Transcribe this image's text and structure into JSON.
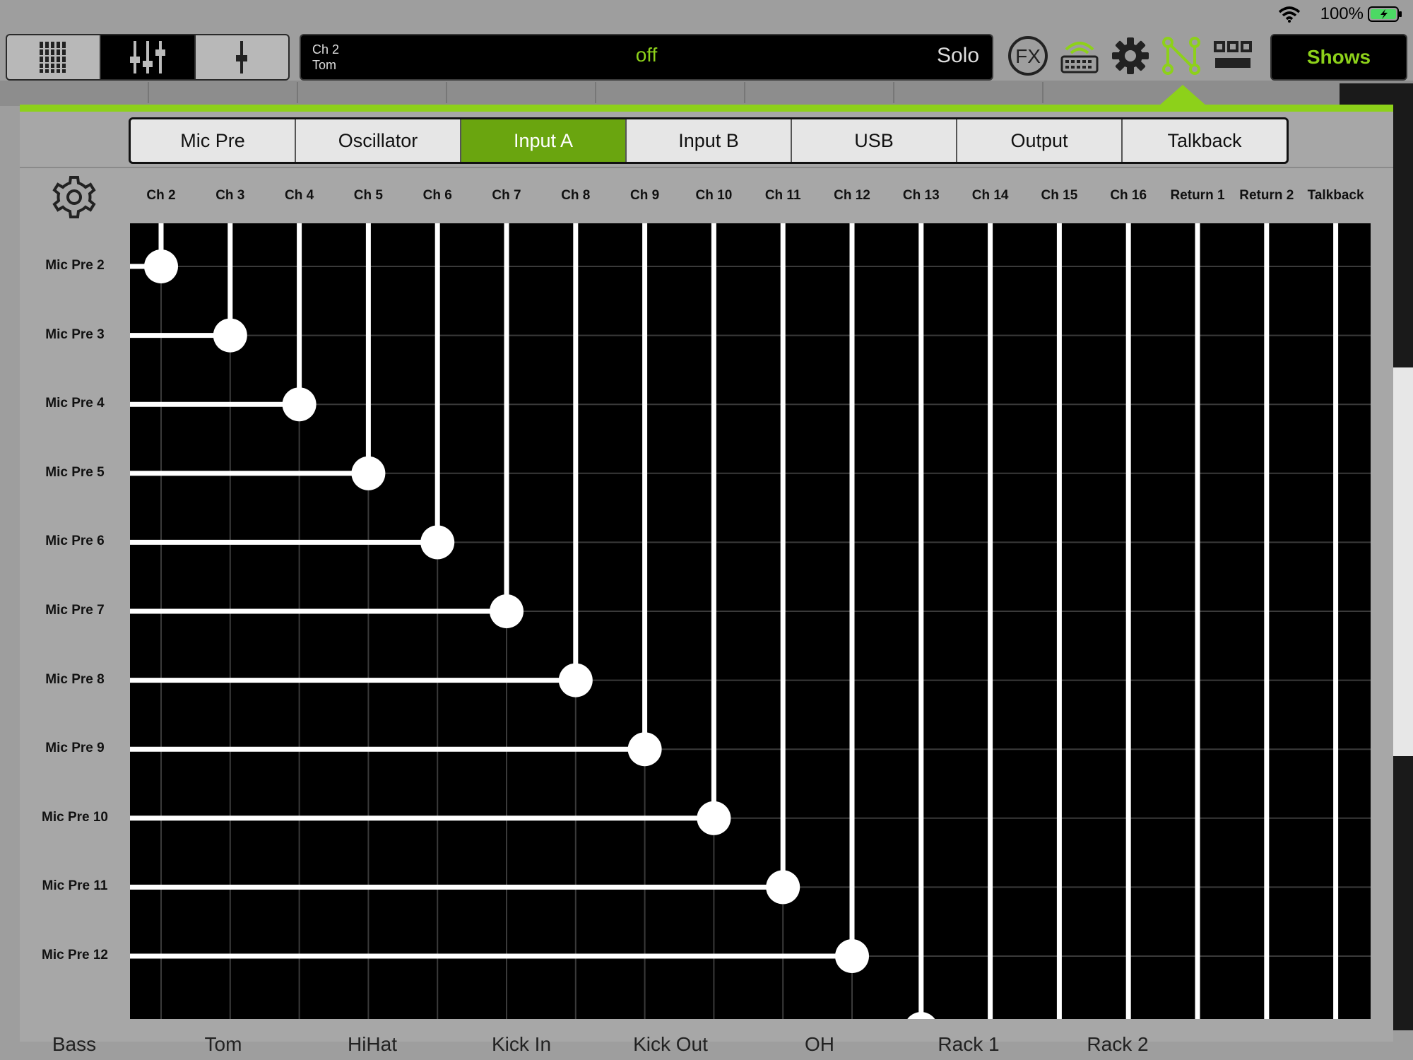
{
  "status_bar": {
    "battery_text": "100%",
    "icons": [
      "wifi-icon",
      "battery-charging-icon"
    ]
  },
  "toolbar": {
    "view_modes": [
      {
        "name": "meters-view",
        "icon": "meters-icon",
        "active": false
      },
      {
        "name": "mixer-view",
        "icon": "faders-icon",
        "active": true
      },
      {
        "name": "channel-view",
        "icon": "single-fader-icon",
        "active": false
      }
    ],
    "channel_display": {
      "channel": "Ch 2",
      "name": "Tom",
      "state": "off",
      "solo": "Solo"
    },
    "tools": [
      {
        "name": "fx-button",
        "icon": "fx-icon"
      },
      {
        "name": "keyboard-button",
        "icon": "keyboard-wifi-icon"
      },
      {
        "name": "settings-button",
        "icon": "gear-icon"
      },
      {
        "name": "patchbay-button",
        "icon": "patchbay-icon",
        "active": true
      },
      {
        "name": "layout-button",
        "icon": "grid-layout-icon"
      }
    ],
    "shows_label": "Shows"
  },
  "background_channel_names": [
    "Bass",
    "Tom",
    "HiHat",
    "Kick In",
    "Kick Out",
    "OH",
    "Rack 1",
    "Rack 2"
  ],
  "patchbay": {
    "tabs": [
      {
        "label": "Mic Pre",
        "active": false
      },
      {
        "label": "Oscillator",
        "active": false
      },
      {
        "label": "Input A",
        "active": true
      },
      {
        "label": "Input B",
        "active": false
      },
      {
        "label": "USB",
        "active": false
      },
      {
        "label": "Output",
        "active": false
      },
      {
        "label": "Talkback",
        "active": false
      }
    ],
    "settings_icon": "gear-icon",
    "destinations": [
      "Ch 2",
      "Ch 3",
      "Ch 4",
      "Ch 5",
      "Ch 6",
      "Ch 7",
      "Ch 8",
      "Ch 9",
      "Ch 10",
      "Ch 11",
      "Ch 12",
      "Ch 13",
      "Ch 14",
      "Ch 15",
      "Ch 16",
      "Return 1",
      "Return 2",
      "Talkback"
    ],
    "sources": [
      "Mic Pre 2",
      "Mic Pre 3",
      "Mic Pre 4",
      "Mic Pre 5",
      "Mic Pre 6",
      "Mic Pre 7",
      "Mic Pre 8",
      "Mic Pre 9",
      "Mic Pre 10",
      "Mic Pre 11",
      "Mic Pre 12"
    ],
    "routes": [
      {
        "source": "Mic Pre 2",
        "destination": "Ch 2"
      },
      {
        "source": "Mic Pre 3",
        "destination": "Ch 3"
      },
      {
        "source": "Mic Pre 4",
        "destination": "Ch 4"
      },
      {
        "source": "Mic Pre 5",
        "destination": "Ch 5"
      },
      {
        "source": "Mic Pre 6",
        "destination": "Ch 6"
      },
      {
        "source": "Mic Pre 7",
        "destination": "Ch 7"
      },
      {
        "source": "Mic Pre 8",
        "destination": "Ch 8"
      },
      {
        "source": "Mic Pre 9",
        "destination": "Ch 9"
      },
      {
        "source": "Mic Pre 10",
        "destination": "Ch 10"
      },
      {
        "source": "Mic Pre 11",
        "destination": "Ch 11"
      },
      {
        "source": "Mic Pre 12",
        "destination": "Ch 12"
      }
    ],
    "colors": {
      "accent": "#8dd11a",
      "active_tab": "#6aa50f",
      "grid_bg": "#000000",
      "cable": "#ffffff"
    }
  }
}
